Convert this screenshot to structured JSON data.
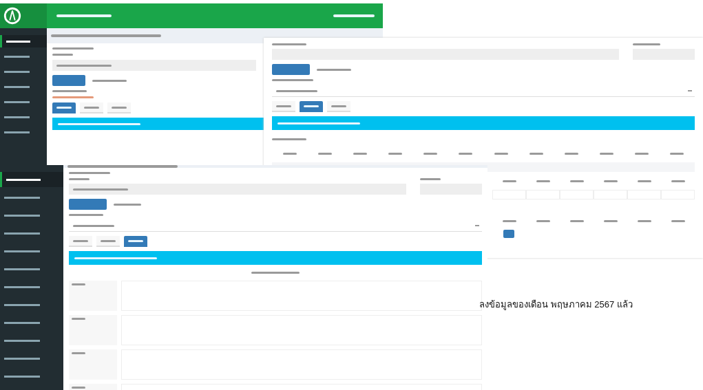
{
  "caption": "ลงข้อมูลของเดือน พฤษภาคม 2567 แล้ว",
  "windows": [
    {
      "kind": "back",
      "sidebar": [
        {
          "selected": true
        },
        {
          "selected": false
        },
        {
          "selected": false
        },
        {
          "selected": false
        },
        {
          "selected": false
        },
        {
          "selected": false
        },
        {
          "selected": false
        }
      ],
      "tabs": [
        {
          "selected": true
        },
        {
          "selected": false
        },
        {
          "selected": false
        }
      ]
    },
    {
      "kind": "middle",
      "tabs": [
        {
          "selected": false
        },
        {
          "selected": true
        },
        {
          "selected": false
        }
      ]
    },
    {
      "kind": "front",
      "sidebar": [
        {
          "selected": true
        },
        {
          "selected": false
        },
        {
          "selected": false
        },
        {
          "selected": false
        },
        {
          "selected": false
        },
        {
          "selected": false
        },
        {
          "selected": false
        },
        {
          "selected": false
        },
        {
          "selected": false
        },
        {
          "selected": false
        },
        {
          "selected": false
        },
        {
          "selected": false
        }
      ],
      "tabs": [
        {
          "selected": false
        },
        {
          "selected": false
        },
        {
          "selected": true
        }
      ]
    }
  ]
}
